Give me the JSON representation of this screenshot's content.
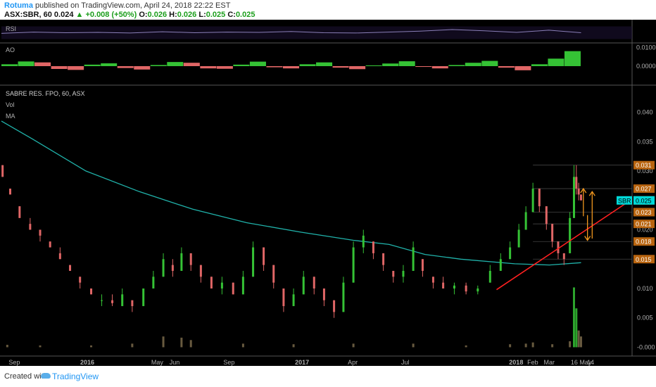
{
  "header": {
    "author": "Rotuma",
    "published": "published on TradingView.com, April 24, 2018 22:22 EST",
    "symbol": "ASX:SBR, 60",
    "last": "0.024",
    "change": "+0.008 (+50%)",
    "o_label": "O:",
    "o": "0.026",
    "h_label": "H:",
    "h": "0.026",
    "l_label": "L:",
    "l": "0.025",
    "c_label": "C:",
    "c": "0.025"
  },
  "footer": {
    "created_with": "Created with",
    "brand": "TradingView"
  },
  "colors": {
    "up": "#35c235",
    "down": "#e06666",
    "ma": "#20b2aa",
    "trend": "#ff2020",
    "arrow": "#f0961e",
    "ticker": "#00d9d9",
    "price_box": "#b8640f"
  },
  "chart_data": [
    {
      "type": "line",
      "title": "RSI",
      "x_type": "time",
      "x_range": [
        "2015-08-10",
        "2018-04-24"
      ],
      "ylim": [
        20,
        80
      ],
      "series": [
        {
          "values": [
            48,
            52,
            50,
            51,
            49,
            53,
            50,
            52,
            51,
            54,
            50,
            49,
            52,
            55,
            60,
            56,
            51,
            58,
            50
          ]
        }
      ]
    },
    {
      "type": "bar",
      "title": "AO",
      "x_type": "time",
      "x_range": [
        "2015-08-10",
        "2018-04-24"
      ],
      "y_ticks": [
        "0.0100",
        "0.0000"
      ],
      "ylim": [
        -0.006,
        0.012
      ],
      "values": [
        0.001,
        0.0025,
        0.002,
        -0.0015,
        -0.002,
        0.0008,
        0.0015,
        -0.001,
        -0.0018,
        0.0006,
        0.0022,
        0.0018,
        -0.0012,
        -0.0014,
        0.0008,
        0.0024,
        -0.0006,
        -0.0012,
        0.001,
        0.002,
        -0.0008,
        -0.0016,
        0.0004,
        0.0014,
        0.0026,
        -0.0004,
        -0.0012,
        0.0006,
        0.0018,
        0.0028,
        -0.0008,
        -0.0022,
        0.001,
        0.004,
        0.008
      ]
    },
    {
      "type": "candlestick",
      "title": "SABRE RES. FPO, 60, ASX",
      "legend": [
        "Vol",
        "MA"
      ],
      "x_type": "time",
      "x_range": [
        "2015-08-10",
        "2018-07-20"
      ],
      "x_ticks": [
        {
          "label": "Sep",
          "date": "2015-09-01"
        },
        {
          "label": "2016",
          "date": "2016-01-01"
        },
        {
          "label": "May",
          "date": "2016-05-01"
        },
        {
          "label": "Jun",
          "date": "2016-06-01"
        },
        {
          "label": "Sep",
          "date": "2016-09-01"
        },
        {
          "label": "2017",
          "date": "2017-01-01"
        },
        {
          "label": "Apr",
          "date": "2017-04-01"
        },
        {
          "label": "Jul",
          "date": "2017-07-01"
        },
        {
          "label": "2018",
          "date": "2018-01-01"
        },
        {
          "label": "Feb",
          "date": "2018-02-01"
        },
        {
          "label": "Mar",
          "date": "2018-03-01"
        },
        {
          "label": "16",
          "date": "2018-04-16"
        },
        {
          "label": "May",
          "date": "2018-05-01"
        },
        {
          "label": "14",
          "date": "2018-05-14"
        }
      ],
      "y_ticks": [
        "0.040",
        "0.035",
        "0.030",
        "0.025",
        "0.020",
        "0.015",
        "0.010",
        "0.005",
        "-0.000"
      ],
      "ylim": [
        -0.0015,
        0.0445
      ],
      "price_labels": [
        "0.031",
        "0.027",
        "0.025",
        "0.023",
        "0.021",
        "0.018",
        "0.015"
      ],
      "last_price": {
        "ticker": "SBR",
        "value": "0.025"
      },
      "candles": [
        {
          "date": "2015-08-12",
          "o": 0.031,
          "h": 0.031,
          "l": 0.029,
          "c": 0.029
        },
        {
          "date": "2015-08-25",
          "o": 0.027,
          "h": 0.027,
          "l": 0.026,
          "c": 0.026
        },
        {
          "date": "2015-09-10",
          "o": 0.024,
          "h": 0.024,
          "l": 0.022,
          "c": 0.022
        },
        {
          "date": "2015-09-28",
          "o": 0.021,
          "h": 0.022,
          "l": 0.02,
          "c": 0.02
        },
        {
          "date": "2015-10-15",
          "o": 0.02,
          "h": 0.02,
          "l": 0.018,
          "c": 0.019
        },
        {
          "date": "2015-11-01",
          "o": 0.018,
          "h": 0.018,
          "l": 0.017,
          "c": 0.017
        },
        {
          "date": "2015-11-18",
          "o": 0.016,
          "h": 0.017,
          "l": 0.015,
          "c": 0.015
        },
        {
          "date": "2015-12-05",
          "o": 0.014,
          "h": 0.014,
          "l": 0.013,
          "c": 0.013
        },
        {
          "date": "2015-12-22",
          "o": 0.012,
          "h": 0.012,
          "l": 0.01,
          "c": 0.011
        },
        {
          "date": "2016-01-10",
          "o": 0.01,
          "h": 0.01,
          "l": 0.009,
          "c": 0.009
        },
        {
          "date": "2016-01-28",
          "o": 0.008,
          "h": 0.009,
          "l": 0.007,
          "c": 0.008
        },
        {
          "date": "2016-02-15",
          "o": 0.008,
          "h": 0.009,
          "l": 0.007,
          "c": 0.0075
        },
        {
          "date": "2016-03-03",
          "o": 0.007,
          "h": 0.01,
          "l": 0.007,
          "c": 0.009
        },
        {
          "date": "2016-03-20",
          "o": 0.008,
          "h": 0.008,
          "l": 0.006,
          "c": 0.007
        },
        {
          "date": "2016-04-08",
          "o": 0.007,
          "h": 0.01,
          "l": 0.007,
          "c": 0.01
        },
        {
          "date": "2016-04-25",
          "o": 0.01,
          "h": 0.013,
          "l": 0.01,
          "c": 0.012
        },
        {
          "date": "2016-05-12",
          "o": 0.012,
          "h": 0.016,
          "l": 0.012,
          "c": 0.015
        },
        {
          "date": "2016-05-28",
          "o": 0.014,
          "h": 0.015,
          "l": 0.012,
          "c": 0.013
        },
        {
          "date": "2016-06-12",
          "o": 0.013,
          "h": 0.017,
          "l": 0.013,
          "c": 0.016
        },
        {
          "date": "2016-06-28",
          "o": 0.016,
          "h": 0.016,
          "l": 0.013,
          "c": 0.014
        },
        {
          "date": "2016-07-15",
          "o": 0.014,
          "h": 0.014,
          "l": 0.011,
          "c": 0.012
        },
        {
          "date": "2016-08-02",
          "o": 0.012,
          "h": 0.012,
          "l": 0.01,
          "c": 0.01
        },
        {
          "date": "2016-08-20",
          "o": 0.01,
          "h": 0.012,
          "l": 0.009,
          "c": 0.011
        },
        {
          "date": "2016-09-08",
          "o": 0.011,
          "h": 0.011,
          "l": 0.009,
          "c": 0.009
        },
        {
          "date": "2016-09-25",
          "o": 0.009,
          "h": 0.013,
          "l": 0.009,
          "c": 0.012
        },
        {
          "date": "2016-10-12",
          "o": 0.012,
          "h": 0.018,
          "l": 0.012,
          "c": 0.017
        },
        {
          "date": "2016-10-30",
          "o": 0.017,
          "h": 0.017,
          "l": 0.013,
          "c": 0.014
        },
        {
          "date": "2016-11-16",
          "o": 0.014,
          "h": 0.014,
          "l": 0.01,
          "c": 0.011
        },
        {
          "date": "2016-12-03",
          "o": 0.01,
          "h": 0.01,
          "l": 0.006,
          "c": 0.007
        },
        {
          "date": "2016-12-20",
          "o": 0.007,
          "h": 0.01,
          "l": 0.007,
          "c": 0.009
        },
        {
          "date": "2017-01-06",
          "o": 0.009,
          "h": 0.013,
          "l": 0.009,
          "c": 0.012
        },
        {
          "date": "2017-01-24",
          "o": 0.012,
          "h": 0.012,
          "l": 0.009,
          "c": 0.01
        },
        {
          "date": "2017-02-10",
          "o": 0.01,
          "h": 0.01,
          "l": 0.007,
          "c": 0.008
        },
        {
          "date": "2017-02-27",
          "o": 0.008,
          "h": 0.008,
          "l": 0.005,
          "c": 0.006
        },
        {
          "date": "2017-03-15",
          "o": 0.006,
          "h": 0.012,
          "l": 0.006,
          "c": 0.011
        },
        {
          "date": "2017-04-01",
          "o": 0.011,
          "h": 0.018,
          "l": 0.011,
          "c": 0.017
        },
        {
          "date": "2017-04-18",
          "o": 0.017,
          "h": 0.02,
          "l": 0.016,
          "c": 0.019
        },
        {
          "date": "2017-05-05",
          "o": 0.018,
          "h": 0.018,
          "l": 0.015,
          "c": 0.016
        },
        {
          "date": "2017-05-22",
          "o": 0.016,
          "h": 0.016,
          "l": 0.013,
          "c": 0.014
        },
        {
          "date": "2017-06-08",
          "o": 0.013,
          "h": 0.013,
          "l": 0.011,
          "c": 0.012
        },
        {
          "date": "2017-06-25",
          "o": 0.012,
          "h": 0.014,
          "l": 0.011,
          "c": 0.013
        },
        {
          "date": "2017-07-12",
          "o": 0.013,
          "h": 0.018,
          "l": 0.013,
          "c": 0.017
        },
        {
          "date": "2017-07-28",
          "o": 0.015,
          "h": 0.015,
          "l": 0.012,
          "c": 0.013
        },
        {
          "date": "2017-08-15",
          "o": 0.012,
          "h": 0.012,
          "l": 0.01,
          "c": 0.011
        },
        {
          "date": "2017-09-01",
          "o": 0.011,
          "h": 0.012,
          "l": 0.01,
          "c": 0.01
        },
        {
          "date": "2017-09-20",
          "o": 0.01,
          "h": 0.011,
          "l": 0.009,
          "c": 0.0105
        },
        {
          "date": "2017-10-10",
          "o": 0.0105,
          "h": 0.011,
          "l": 0.009,
          "c": 0.0095
        },
        {
          "date": "2017-10-30",
          "o": 0.0095,
          "h": 0.0105,
          "l": 0.009,
          "c": 0.01
        },
        {
          "date": "2017-11-20",
          "o": 0.011,
          "h": 0.014,
          "l": 0.011,
          "c": 0.013
        },
        {
          "date": "2017-12-08",
          "o": 0.013,
          "h": 0.016,
          "l": 0.013,
          "c": 0.015
        },
        {
          "date": "2017-12-24",
          "o": 0.015,
          "h": 0.018,
          "l": 0.015,
          "c": 0.017
        },
        {
          "date": "2018-01-08",
          "o": 0.017,
          "h": 0.021,
          "l": 0.017,
          "c": 0.02
        },
        {
          "date": "2018-01-20",
          "o": 0.02,
          "h": 0.024,
          "l": 0.02,
          "c": 0.023
        },
        {
          "date": "2018-02-01",
          "o": 0.023,
          "h": 0.028,
          "l": 0.023,
          "c": 0.027
        },
        {
          "date": "2018-02-12",
          "o": 0.027,
          "h": 0.027,
          "l": 0.023,
          "c": 0.024
        },
        {
          "date": "2018-02-24",
          "o": 0.024,
          "h": 0.024,
          "l": 0.02,
          "c": 0.021
        },
        {
          "date": "2018-03-06",
          "o": 0.021,
          "h": 0.021,
          "l": 0.017,
          "c": 0.018
        },
        {
          "date": "2018-03-16",
          "o": 0.018,
          "h": 0.018,
          "l": 0.015,
          "c": 0.016
        },
        {
          "date": "2018-03-26",
          "o": 0.016,
          "h": 0.016,
          "l": 0.014,
          "c": 0.015
        },
        {
          "date": "2018-04-05",
          "o": 0.016,
          "h": 0.023,
          "l": 0.016,
          "c": 0.022
        },
        {
          "date": "2018-04-12",
          "o": 0.022,
          "h": 0.031,
          "l": 0.022,
          "c": 0.029
        },
        {
          "date": "2018-04-16",
          "o": 0.029,
          "h": 0.031,
          "l": 0.026,
          "c": 0.027
        },
        {
          "date": "2018-04-20",
          "o": 0.027,
          "h": 0.028,
          "l": 0.025,
          "c": 0.026
        },
        {
          "date": "2018-04-24",
          "o": 0.026,
          "h": 0.026,
          "l": 0.025,
          "c": 0.025
        }
      ],
      "ma": [
        {
          "date": "2015-08-10",
          "value": 0.0385
        },
        {
          "date": "2015-10-01",
          "value": 0.0355
        },
        {
          "date": "2016-01-01",
          "value": 0.03
        },
        {
          "date": "2016-04-01",
          "value": 0.0265
        },
        {
          "date": "2016-07-01",
          "value": 0.0235
        },
        {
          "date": "2016-10-01",
          "value": 0.0212
        },
        {
          "date": "2017-01-01",
          "value": 0.0196
        },
        {
          "date": "2017-04-01",
          "value": 0.0182
        },
        {
          "date": "2017-06-01",
          "value": 0.0175
        },
        {
          "date": "2017-08-01",
          "value": 0.0158
        },
        {
          "date": "2017-10-01",
          "value": 0.015
        },
        {
          "date": "2018-01-01",
          "value": 0.0142
        },
        {
          "date": "2018-03-01",
          "value": 0.014
        },
        {
          "date": "2018-04-24",
          "value": 0.0144
        }
      ],
      "volume": [
        {
          "date": "2015-08-20",
          "v": 0.04
        },
        {
          "date": "2015-10-15",
          "v": 0.03
        },
        {
          "date": "2016-01-10",
          "v": 0.03
        },
        {
          "date": "2016-03-20",
          "v": 0.06
        },
        {
          "date": "2016-05-12",
          "v": 0.18
        },
        {
          "date": "2016-06-12",
          "v": 0.16
        },
        {
          "date": "2016-06-28",
          "v": 0.12
        },
        {
          "date": "2016-09-25",
          "v": 0.06
        },
        {
          "date": "2016-12-20",
          "v": 0.05
        },
        {
          "date": "2017-04-01",
          "v": 0.06
        },
        {
          "date": "2017-07-12",
          "v": 0.06
        },
        {
          "date": "2017-10-10",
          "v": 0.03
        },
        {
          "date": "2017-12-24",
          "v": 0.05
        },
        {
          "date": "2018-01-20",
          "v": 0.06
        },
        {
          "date": "2018-02-01",
          "v": 0.08
        },
        {
          "date": "2018-03-06",
          "v": 0.05
        },
        {
          "date": "2018-04-05",
          "v": 0.1
        },
        {
          "date": "2018-04-12",
          "v": 1.0
        },
        {
          "date": "2018-04-16",
          "v": 0.65
        },
        {
          "date": "2018-04-20",
          "v": 0.28
        },
        {
          "date": "2018-04-24",
          "v": 0.18
        }
      ],
      "trendline": [
        {
          "date": "2017-12-01",
          "value": 0.0098
        },
        {
          "date": "2018-07-20",
          "value": 0.0252
        }
      ],
      "arrows": [
        {
          "date": "2018-04-28",
          "from": 0.0223,
          "to": 0.027
        },
        {
          "date": "2018-05-05",
          "from": 0.0225,
          "to": 0.0182
        },
        {
          "date": "2018-05-13",
          "from": 0.0185,
          "to": 0.0265
        }
      ]
    }
  ]
}
